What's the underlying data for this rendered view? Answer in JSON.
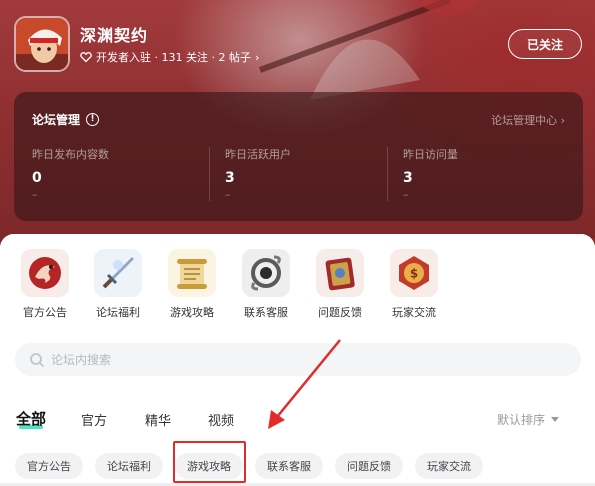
{
  "header": {
    "game_name": "深渊契约",
    "meta": "开发者入驻 · 131 关注 · 2 帖子",
    "follow_button": "已关注"
  },
  "admin": {
    "title": "论坛管理",
    "link": "论坛管理中心",
    "stats": [
      {
        "label": "昨日发布内容数",
        "value": "0",
        "delta": "–"
      },
      {
        "label": "昨日活跃用户",
        "value": "3",
        "delta": "–"
      },
      {
        "label": "昨日访问量",
        "value": "3",
        "delta": "–"
      }
    ]
  },
  "categories": [
    {
      "label": "官方公告",
      "icon": "dragon-emblem-icon"
    },
    {
      "label": "论坛福利",
      "icon": "sword-icon"
    },
    {
      "label": "游戏攻略",
      "icon": "scroll-icon"
    },
    {
      "label": "联系客服",
      "icon": "chain-badge-icon"
    },
    {
      "label": "问题反馈",
      "icon": "spellbook-icon"
    },
    {
      "label": "玩家交流",
      "icon": "coin-badge-icon"
    }
  ],
  "search": {
    "placeholder": "论坛内搜索"
  },
  "tabs": [
    {
      "label": "全部",
      "active": true
    },
    {
      "label": "官方"
    },
    {
      "label": "精华"
    },
    {
      "label": "视频"
    }
  ],
  "sort": {
    "label": "默认排序"
  },
  "chips": [
    "官方公告",
    "论坛福利",
    "游戏攻略",
    "联系客服",
    "问题反馈",
    "玩家交流"
  ],
  "colors": {
    "accent_tab_underline": "#2ee0c0",
    "annotation_red": "#e32b2b",
    "hero_red": "#8e2f31"
  }
}
